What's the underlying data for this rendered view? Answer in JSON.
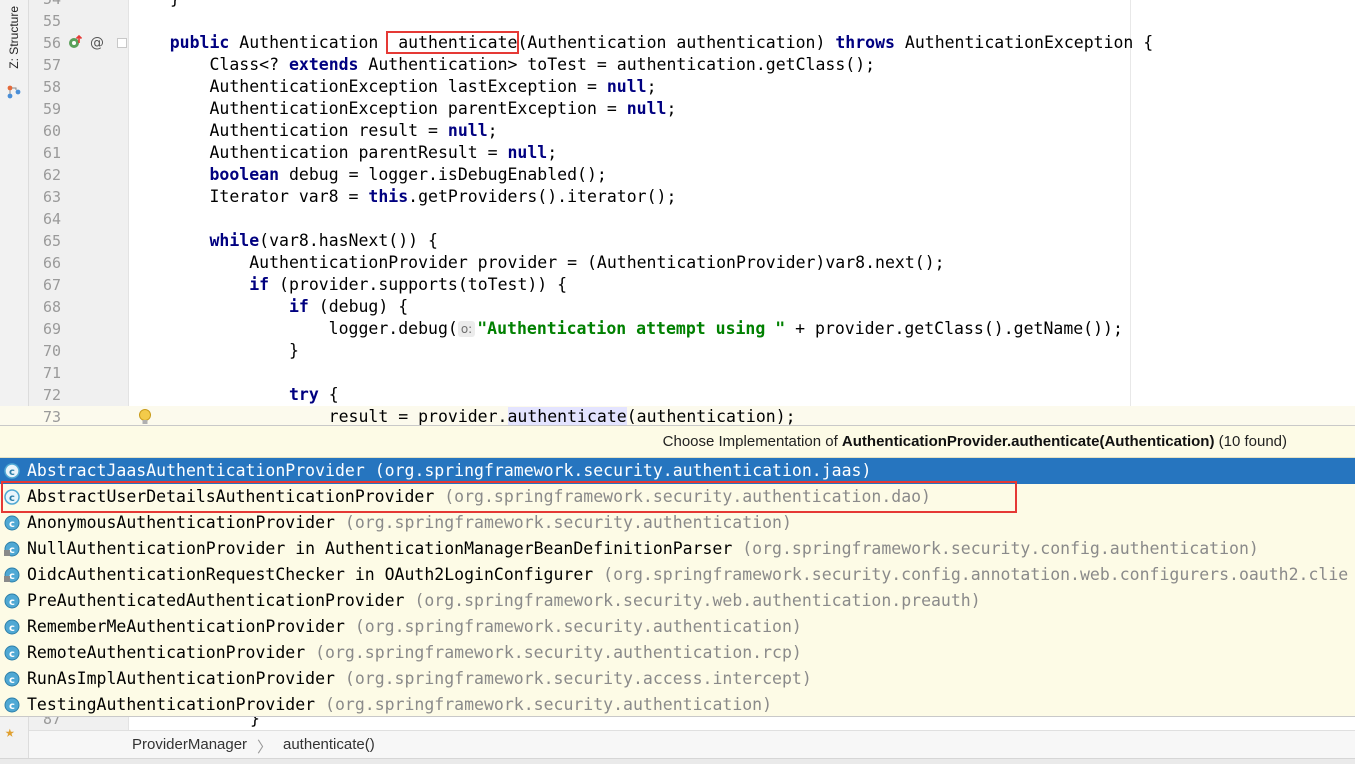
{
  "sidebar": {
    "structure_label": "Z: Structure"
  },
  "editor": {
    "top_partial": {
      "num": "54",
      "code": "}"
    },
    "lines": [
      {
        "num": "55",
        "parts": []
      },
      {
        "num": "56",
        "parts": [
          {
            "t": "    "
          },
          {
            "t": "public",
            "c": "kw"
          },
          {
            "t": " Authentication "
          },
          {
            "t": " authenticate",
            "c": "hl-box"
          },
          {
            "t": "(Authentication authentication) "
          },
          {
            "t": "throws",
            "c": "kw"
          },
          {
            "t": " AuthenticationException {"
          }
        ]
      },
      {
        "num": "57",
        "parts": [
          {
            "t": "        Class<? "
          },
          {
            "t": "extends",
            "c": "kw"
          },
          {
            "t": " Authentication> toTest = authentication.getClass();"
          }
        ]
      },
      {
        "num": "58",
        "parts": [
          {
            "t": "        AuthenticationException lastException = "
          },
          {
            "t": "null",
            "c": "kw"
          },
          {
            "t": ";"
          }
        ]
      },
      {
        "num": "59",
        "parts": [
          {
            "t": "        AuthenticationException parentException = "
          },
          {
            "t": "null",
            "c": "kw"
          },
          {
            "t": ";"
          }
        ]
      },
      {
        "num": "60",
        "parts": [
          {
            "t": "        Authentication result = "
          },
          {
            "t": "null",
            "c": "kw"
          },
          {
            "t": ";"
          }
        ]
      },
      {
        "num": "61",
        "parts": [
          {
            "t": "        Authentication parentResult = "
          },
          {
            "t": "null",
            "c": "kw"
          },
          {
            "t": ";"
          }
        ]
      },
      {
        "num": "62",
        "parts": [
          {
            "t": "        "
          },
          {
            "t": "boolean",
            "c": "kw"
          },
          {
            "t": " debug = logger.isDebugEnabled();"
          }
        ]
      },
      {
        "num": "63",
        "parts": [
          {
            "t": "        Iterator var8 = "
          },
          {
            "t": "this",
            "c": "kw"
          },
          {
            "t": ".getProviders().iterator();"
          }
        ]
      },
      {
        "num": "64",
        "parts": []
      },
      {
        "num": "65",
        "parts": [
          {
            "t": "        "
          },
          {
            "t": "while",
            "c": "kw"
          },
          {
            "t": "(var8.hasNext()) {"
          }
        ]
      },
      {
        "num": "66",
        "parts": [
          {
            "t": "            AuthenticationProvider provider = (AuthenticationProvider)var8.next();"
          }
        ]
      },
      {
        "num": "67",
        "parts": [
          {
            "t": "            "
          },
          {
            "t": "if",
            "c": "kw"
          },
          {
            "t": " (provider.supports(toTest)) {"
          }
        ]
      },
      {
        "num": "68",
        "parts": [
          {
            "t": "                "
          },
          {
            "t": "if",
            "c": "kw"
          },
          {
            "t": " (debug) {"
          }
        ]
      },
      {
        "num": "69",
        "parts": [
          {
            "t": "                    logger.debug("
          },
          {
            "t": "o:",
            "c": "hint"
          },
          {
            "t": "\"Authentication attempt using \"",
            "c": "str"
          },
          {
            "t": " + provider.getClass().getName());"
          }
        ]
      },
      {
        "num": "70",
        "parts": [
          {
            "t": "                }"
          }
        ]
      },
      {
        "num": "71",
        "parts": []
      },
      {
        "num": "72",
        "parts": [
          {
            "t": "                "
          },
          {
            "t": "try",
            "c": "kw"
          },
          {
            "t": " {"
          }
        ]
      },
      {
        "num": "73",
        "current": true,
        "parts": [
          {
            "t": "                    result = provider."
          },
          {
            "t": "authenticate",
            "c": "usage"
          },
          {
            "t": "(authentication);"
          }
        ]
      }
    ],
    "below_popup": {
      "num": "87",
      "code": "}"
    }
  },
  "popup": {
    "title_prefix": "Choose Implementation of ",
    "title_bold": "AuthenticationProvider.authenticate(Authentication)",
    "title_suffix": " (10 found)",
    "items": [
      {
        "name": "AbstractJaasAuthenticationProvider",
        "pkg": "(org.springframework.security.authentication.jaas)",
        "icon": "class-abstract-icon",
        "selected": true
      },
      {
        "name": "AbstractUserDetailsAuthenticationProvider",
        "pkg": "(org.springframework.security.authentication.dao)",
        "icon": "class-abstract-icon"
      },
      {
        "name": "AnonymousAuthenticationProvider",
        "pkg": "(org.springframework.security.authentication)",
        "icon": "class-icon"
      },
      {
        "name": "NullAuthenticationProvider in AuthenticationManagerBeanDefinitionParser",
        "pkg": "(org.springframework.security.config.authentication)",
        "icon": "inner-class-icon"
      },
      {
        "name": "OidcAuthenticationRequestChecker in OAuth2LoginConfigurer",
        "pkg": "(org.springframework.security.config.annotation.web.configurers.oauth2.clie",
        "icon": "inner-class-icon"
      },
      {
        "name": "PreAuthenticatedAuthenticationProvider",
        "pkg": "(org.springframework.security.web.authentication.preauth)",
        "icon": "class-icon"
      },
      {
        "name": "RememberMeAuthenticationProvider",
        "pkg": "(org.springframework.security.authentication)",
        "icon": "class-icon"
      },
      {
        "name": "RemoteAuthenticationProvider",
        "pkg": "(org.springframework.security.authentication.rcp)",
        "icon": "class-icon"
      },
      {
        "name": "RunAsImplAuthenticationProvider",
        "pkg": "(org.springframework.security.access.intercept)",
        "icon": "class-icon"
      },
      {
        "name": "TestingAuthenticationProvider",
        "pkg": "(org.springframework.security.authentication)",
        "icon": "class-icon"
      }
    ]
  },
  "breadcrumb": {
    "class": "ProviderManager",
    "separator": "〉",
    "method": "authenticate()"
  },
  "colors": {
    "keyword": "#000080",
    "string": "#008000",
    "selection": "#2675bf",
    "class_icon": "#3d9fc8",
    "highlight_box": "#e53935"
  }
}
